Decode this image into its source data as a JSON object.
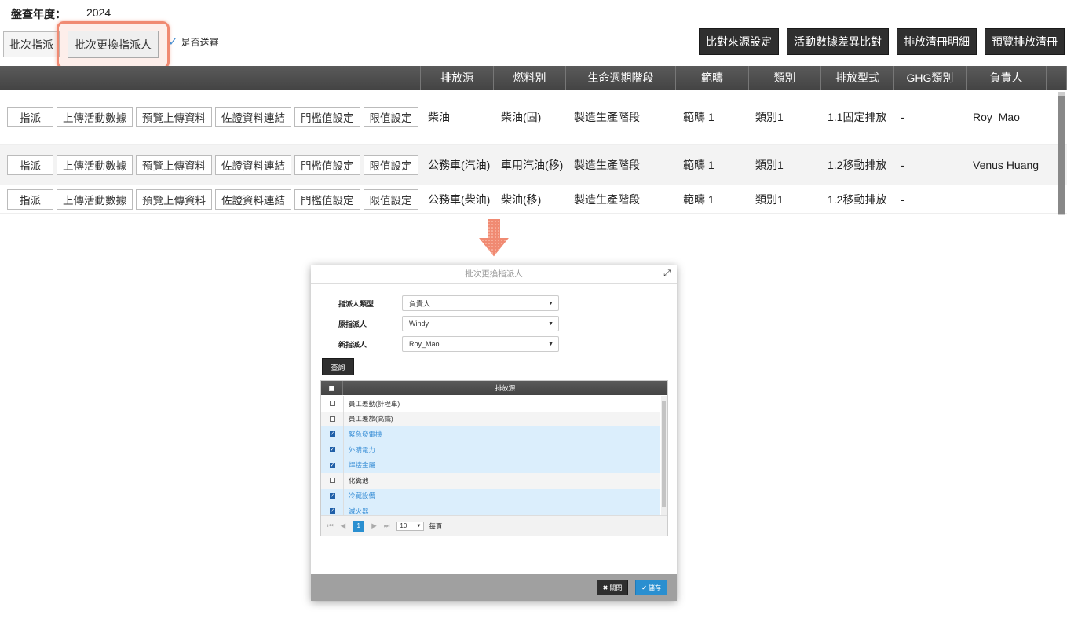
{
  "header": {
    "year_label": "盤查年度：",
    "year_value": "2024"
  },
  "toolbar": {
    "batch_assign_label": "批次指派",
    "batch_change_label": "批次更換指派人",
    "send_review_label": "是否送審",
    "right_buttons": [
      "比對來源設定",
      "活動數據差異比對",
      "排放清冊明細",
      "預覽排放清冊"
    ]
  },
  "table": {
    "columns": [
      "排放源",
      "燃料別",
      "生命週期階段",
      "範疇",
      "類別",
      "排放型式",
      "GHG類別",
      "負責人"
    ],
    "row_actions": [
      "指派",
      "上傳活動數據",
      "預覽上傳資料",
      "佐證資料連結",
      "門檻值設定",
      "限值設定"
    ],
    "rows": [
      {
        "source": "柴油",
        "fuel": "柴油(固)",
        "stage": "製造生產階段",
        "scope": "範疇 1",
        "category": "類別1",
        "type": "1.1固定排放",
        "ghg": "-",
        "owner": "Roy_Mao"
      },
      {
        "source": "公務車(汽油)",
        "fuel": "車用汽油(移)",
        "stage": "製造生產階段",
        "scope": "範疇 1",
        "category": "類別1",
        "type": "1.2移動排放",
        "ghg": "-",
        "owner": "Venus Huang"
      },
      {
        "source": "公務車(柴油)",
        "fuel": "柴油(移)",
        "stage": "製造生產階段",
        "scope": "範疇 1",
        "category": "類別1",
        "type": "1.2移動排放",
        "ghg": "-",
        "owner": ""
      }
    ]
  },
  "modal": {
    "title": "批次更換指派人",
    "fields": [
      {
        "label": "指派人類型",
        "value": "負責人"
      },
      {
        "label": "原指派人",
        "value": "Windy"
      },
      {
        "label": "新指派人",
        "value": "Roy_Mao"
      }
    ],
    "query_label": "查詢",
    "grid_header": "排放源",
    "grid_rows": [
      {
        "label": "員工差勤(計程車)",
        "checked": false
      },
      {
        "label": "員工差旅(高鐵)",
        "checked": false
      },
      {
        "label": "緊急發電機",
        "checked": true
      },
      {
        "label": "外購電力",
        "checked": true
      },
      {
        "label": "焊接金屬",
        "checked": true
      },
      {
        "label": "化糞池",
        "checked": false
      },
      {
        "label": "冷藏設備",
        "checked": true
      },
      {
        "label": "滅火器",
        "checked": true
      }
    ],
    "pager": {
      "current_page": "1",
      "page_size": "10",
      "per_page_label": "每頁"
    },
    "close_label": "關閉",
    "save_label": "儲存"
  },
  "colors": {
    "highlight": "#f08a72",
    "primary": "#2a8fd0",
    "header_dark": "#4a4a4a"
  }
}
